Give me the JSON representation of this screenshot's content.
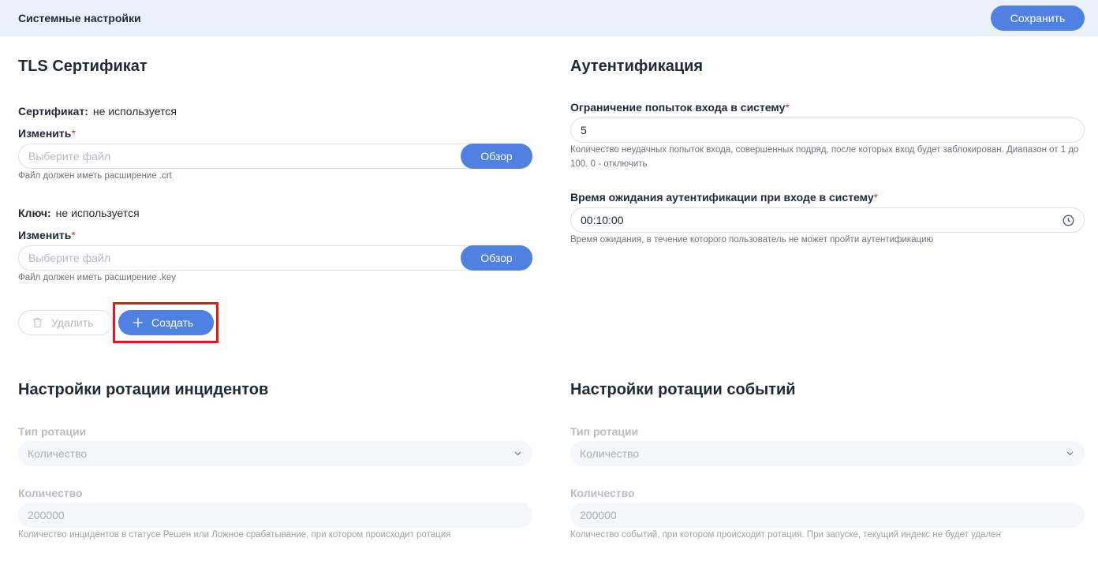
{
  "header": {
    "title": "Системные настройки",
    "save_label": "Сохранить"
  },
  "tls": {
    "title": "TLS Сертификат",
    "cert_label": "Сертификат:",
    "cert_value": "не используется",
    "cert_change_label": "Изменить",
    "cert_placeholder": "Выберите файл",
    "cert_browse": "Обзор",
    "cert_hint": "Файл должен иметь расширение .crt",
    "key_label": "Ключ:",
    "key_value": "не используется",
    "key_change_label": "Изменить",
    "key_placeholder": "Выберите файл",
    "key_browse": "Обзор",
    "key_hint": "Файл должен иметь расширение .key",
    "delete_label": "Удалить",
    "create_label": "Создать"
  },
  "auth": {
    "title": "Аутентификация",
    "attempts_label": "Ограничение попыток входа в систему",
    "attempts_value": "5",
    "attempts_hint": "Количество неудачных попыток входа, совершенных подряд, после которых вход будет заблокирован. Диапазон от 1 до 100. 0 - отключить",
    "timeout_label": "Время ожидания аутентификации при входе в систему",
    "timeout_value": "00:10:00",
    "timeout_hint": "Время ожидания, в течение которого пользователь не может пройти аутентификацию"
  },
  "incidents": {
    "title": "Настройки ротации инцидентов",
    "type_label": "Тип ротации",
    "type_value": "Количество",
    "count_label": "Количество",
    "count_value": "200000",
    "count_hint": "Количество инцидентов в статусе Решен или Ложное срабатывание, при котором происходит ротация"
  },
  "events": {
    "title": "Настройки ротации событий",
    "type_label": "Тип ротации",
    "type_value": "Количество",
    "count_label": "Количество",
    "count_value": "200000",
    "count_hint": "Количество событий, при котором происходит ротация. При запуске, текущий индекс не будет удален"
  },
  "required_mark": "*",
  "colors": {
    "accent": "#4f81e3",
    "highlight": "#e5161e",
    "header_bg": "#eaf1fb"
  }
}
